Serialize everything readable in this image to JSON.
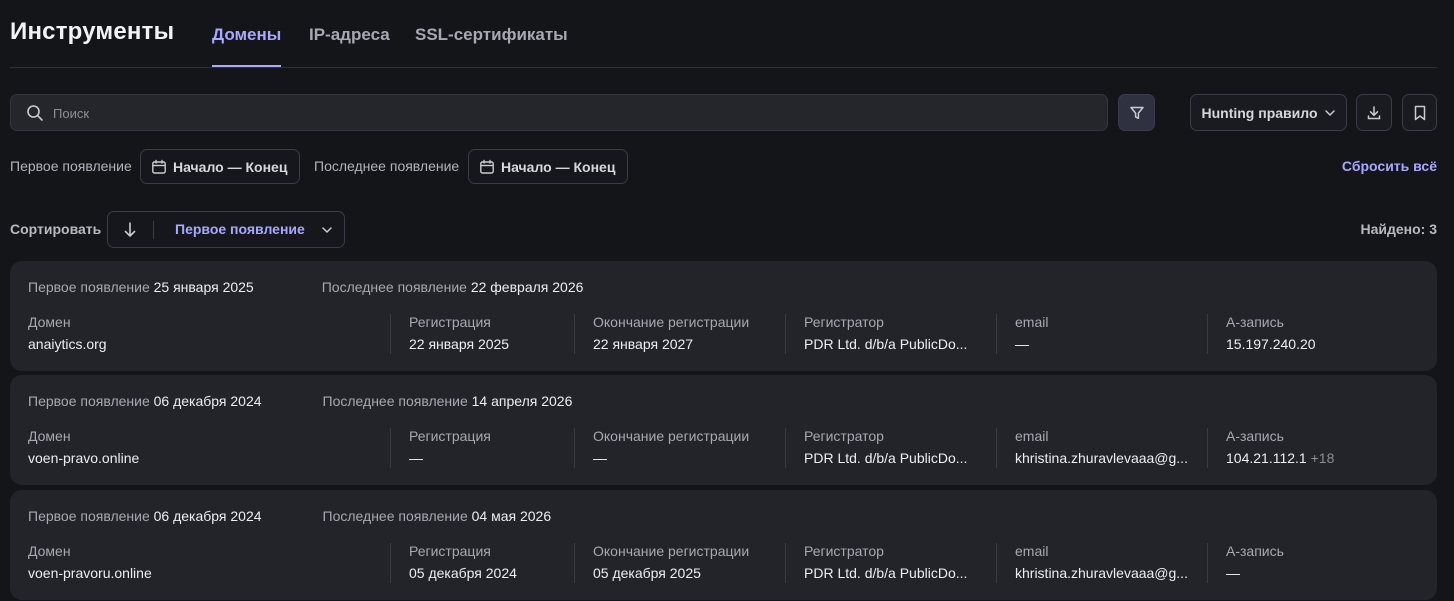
{
  "header": {
    "title": "Инструменты",
    "tabs": [
      {
        "label": "Домены",
        "active": true
      },
      {
        "label": "IP-адреса",
        "active": false
      },
      {
        "label": "SSL-сертификаты",
        "active": false
      }
    ]
  },
  "toolbar": {
    "search_placeholder": "Поиск",
    "hunting_label": "Hunting правило"
  },
  "filters": {
    "first_seen_label": "Первое появление",
    "first_seen_range": "Начало — Конец",
    "last_seen_label": "Последнее появление",
    "last_seen_range": "Начало — Конец",
    "reset_label": "Сбросить всё"
  },
  "sort": {
    "label": "Сортировать",
    "value": "Первое появление",
    "found": "Найдено: 3"
  },
  "columns": {
    "domain": "Домен",
    "registration": "Регистрация",
    "expiry": "Окончание регистрации",
    "registrar": "Регистратор",
    "email": "email",
    "a_record": "A-запись",
    "first_seen": "Первое появление",
    "last_seen": "Последнее появление"
  },
  "results": [
    {
      "first_seen": "25 января 2025",
      "last_seen": "22 февраля 2026",
      "domain": "anaiytics.org",
      "registration": "22 января 2025",
      "expiry": "22 января 2027",
      "registrar": "PDR Ltd. d/b/a PublicDo...",
      "email": "—",
      "a_record": "15.197.240.20",
      "a_record_extra": ""
    },
    {
      "first_seen": "06 декабря 2024",
      "last_seen": "14 апреля 2026",
      "domain": "voen-pravo.online",
      "registration": "—",
      "expiry": "—",
      "registrar": "PDR Ltd. d/b/a PublicDo...",
      "email": "khristina.zhuravlevaaa@g...",
      "a_record": "104.21.112.1",
      "a_record_extra": "+18"
    },
    {
      "first_seen": "06 декабря 2024",
      "last_seen": "04 мая 2026",
      "domain": "voen-pravoru.online",
      "registration": "05 декабря 2024",
      "expiry": "05 декабря 2025",
      "registrar": "PDR Ltd. d/b/a PublicDo...",
      "email": "khristina.zhuravlevaaa@g...",
      "a_record": "—",
      "a_record_extra": ""
    }
  ]
}
